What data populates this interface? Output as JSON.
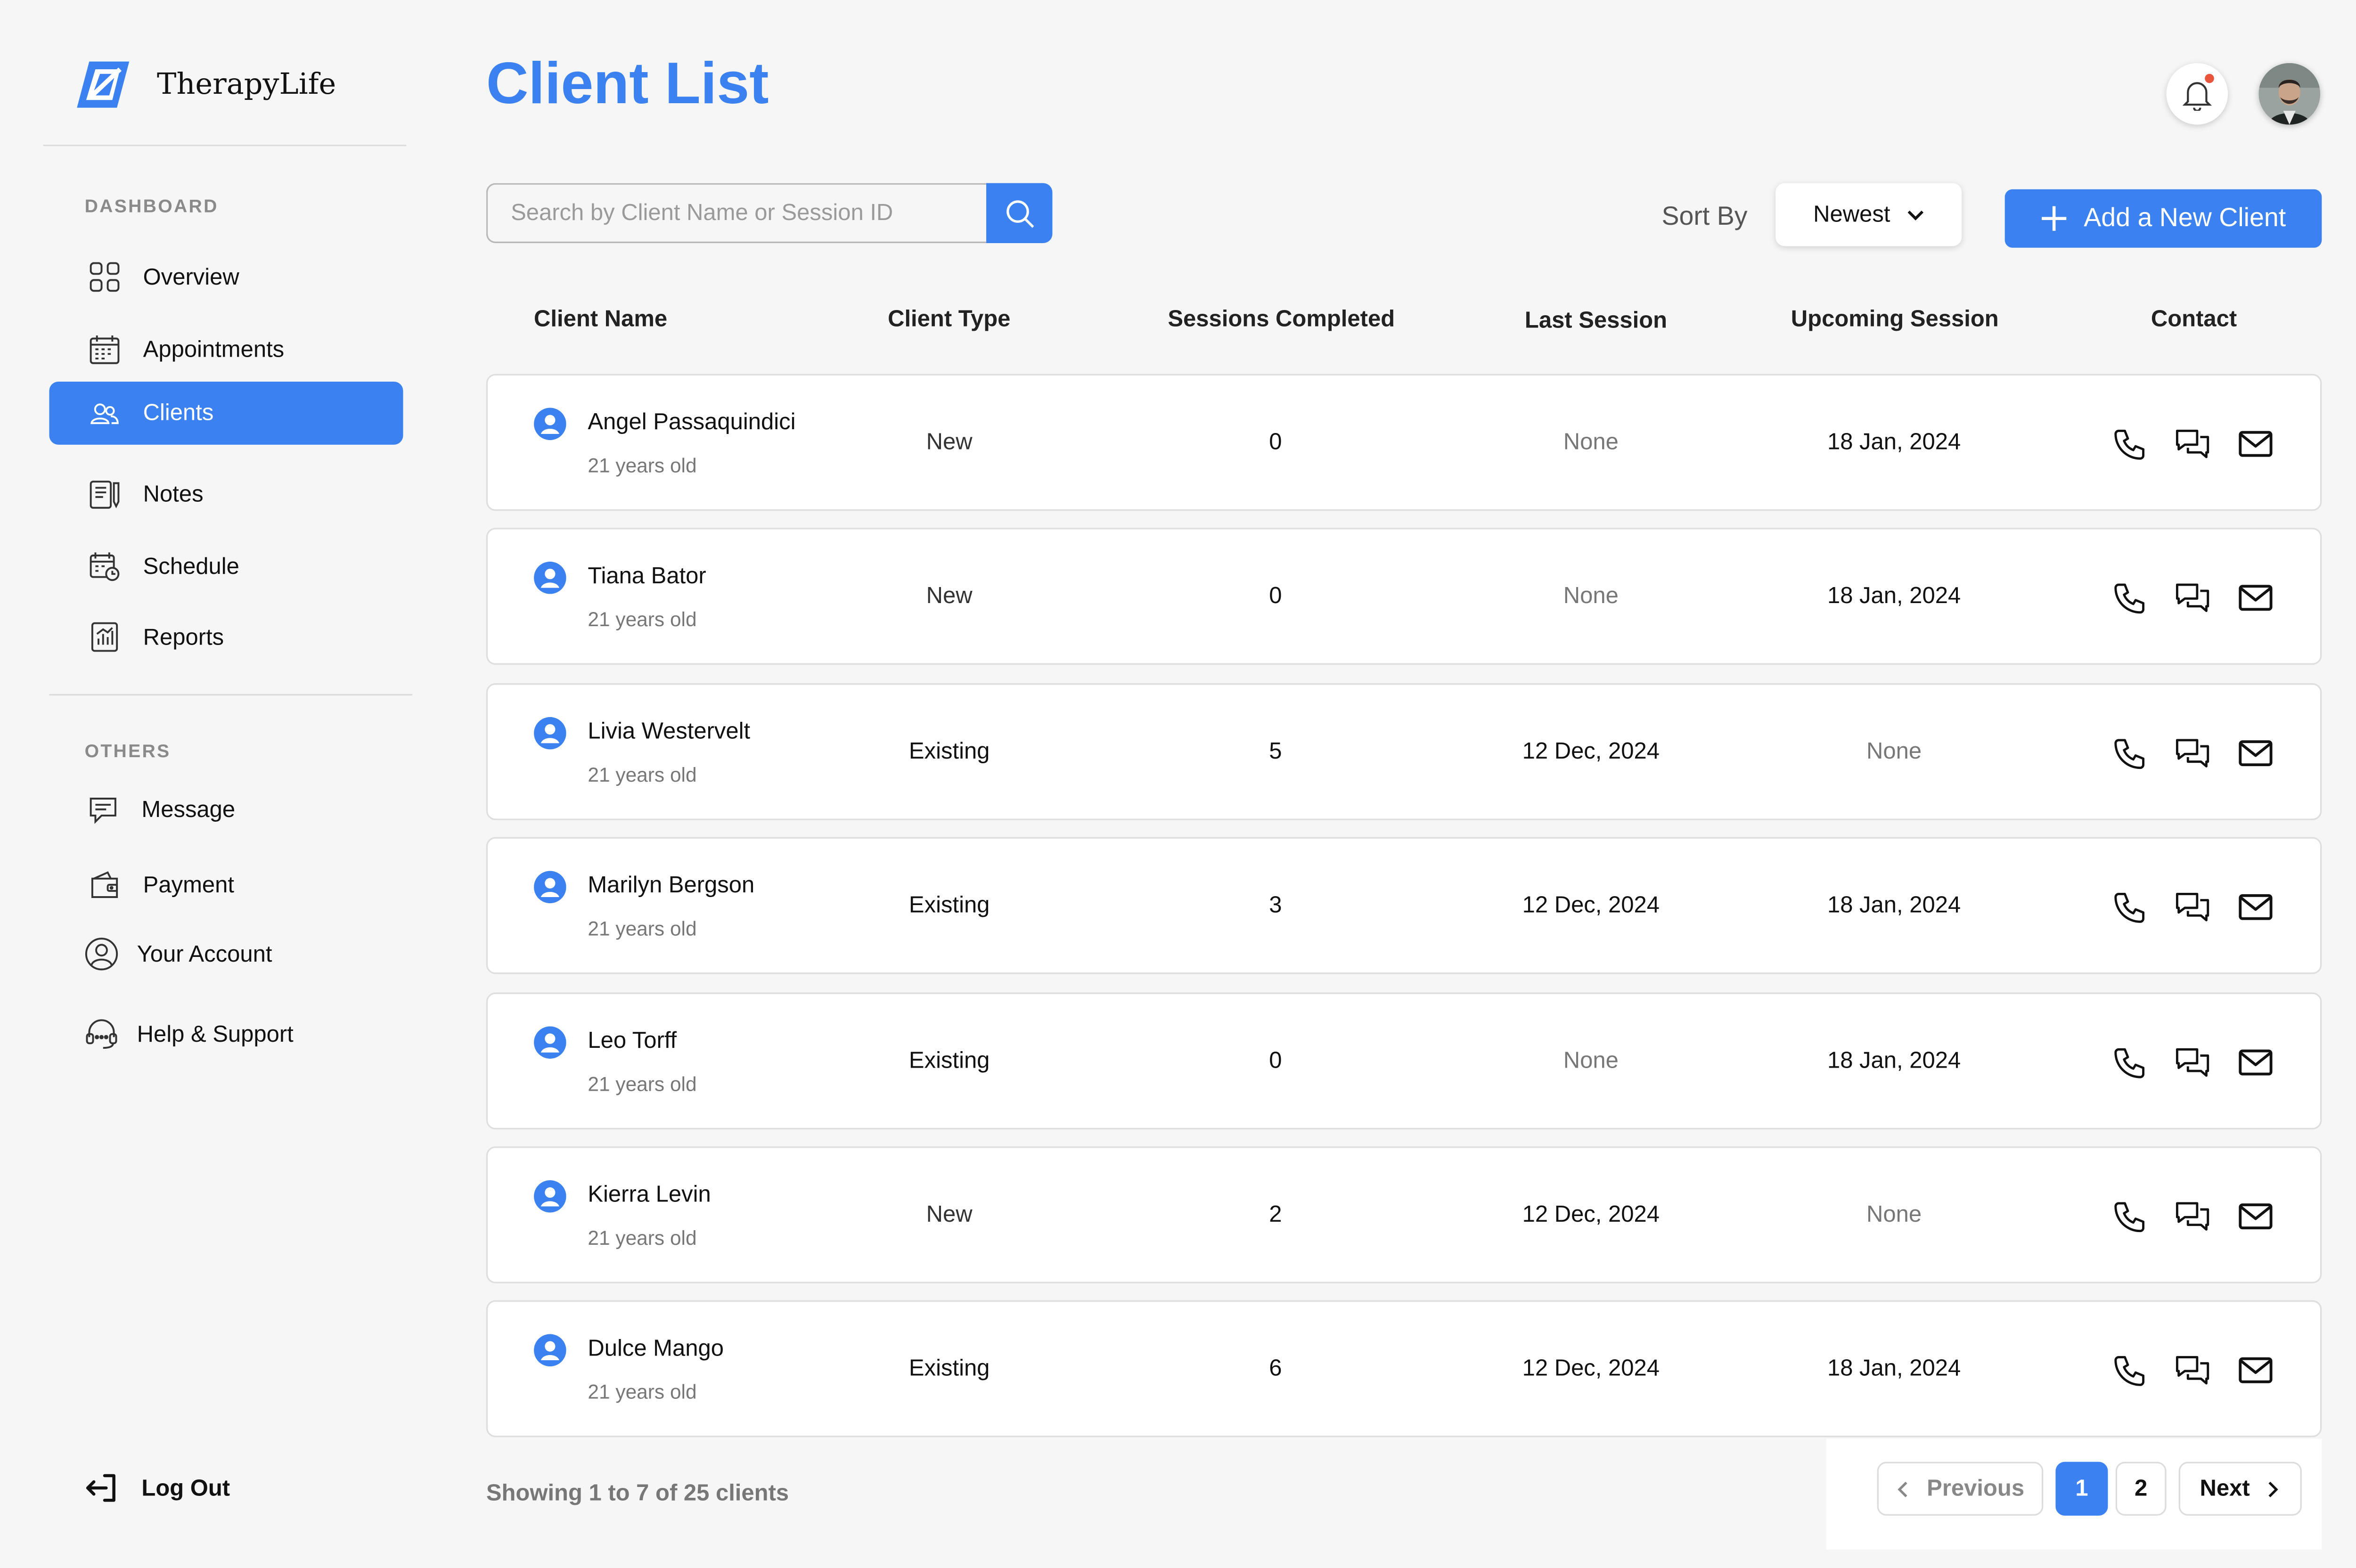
{
  "app": {
    "name": "TherapyLife"
  },
  "colors": {
    "accent": "#3b82f0",
    "notification_dot": "#e8543c"
  },
  "sidebar": {
    "section_dashboard": "DASHBOARD",
    "dashboard_items": [
      {
        "label": "Overview",
        "icon": "grid-icon"
      },
      {
        "label": "Appointments",
        "icon": "calendar-icon"
      },
      {
        "label": "Clients",
        "icon": "users-icon",
        "active": true
      },
      {
        "label": "Notes",
        "icon": "notes-icon"
      },
      {
        "label": "Schedule",
        "icon": "schedule-icon"
      },
      {
        "label": "Reports",
        "icon": "reports-icon"
      }
    ],
    "section_others": "OTHERS",
    "other_items": [
      {
        "label": "Message",
        "icon": "message-icon"
      },
      {
        "label": "Payment",
        "icon": "wallet-icon"
      },
      {
        "label": "Your Account",
        "icon": "account-icon"
      },
      {
        "label": "Help & Support",
        "icon": "headset-icon"
      }
    ],
    "logout_label": "Log Out"
  },
  "header": {
    "title": "Client List"
  },
  "toolbar": {
    "search_placeholder": "Search by Client Name or Session ID",
    "sort_label": "Sort By",
    "sort_value": "Newest",
    "add_label": "Add a New Client"
  },
  "table": {
    "columns": [
      "Client Name",
      "Client Type",
      "Sessions Completed",
      "Last Session",
      "Upcoming Session",
      "Contact"
    ],
    "rows": [
      {
        "name": "Angel Passaquindici",
        "age": "21 years old",
        "type": "New",
        "sessions": "0",
        "last": "None",
        "upcoming": "18 Jan, 2024"
      },
      {
        "name": "Tiana Bator",
        "age": "21 years old",
        "type": "New",
        "sessions": "0",
        "last": "None",
        "upcoming": "18 Jan, 2024"
      },
      {
        "name": "Livia Westervelt",
        "age": "21 years old",
        "type": "Existing",
        "sessions": "5",
        "last": "12 Dec, 2024",
        "upcoming": "None"
      },
      {
        "name": "Marilyn Bergson",
        "age": "21 years old",
        "type": "Existing",
        "sessions": "3",
        "last": "12 Dec, 2024",
        "upcoming": "18 Jan, 2024"
      },
      {
        "name": "Leo Torff",
        "age": "21 years old",
        "type": "Existing",
        "sessions": "0",
        "last": "None",
        "upcoming": "18 Jan, 2024"
      },
      {
        "name": "Kierra Levin",
        "age": "21 years old",
        "type": "New",
        "sessions": "2",
        "last": "12 Dec, 2024",
        "upcoming": "None"
      },
      {
        "name": "Dulce Mango",
        "age": "21 years old",
        "type": "Existing",
        "sessions": "6",
        "last": "12 Dec, 2024",
        "upcoming": "18 Jan, 2024"
      }
    ]
  },
  "footer": {
    "showing": "Showing 1 to 7 of 25 clients",
    "prev_label": "Previous",
    "pages": [
      "1",
      "2"
    ],
    "current_page": "1",
    "next_label": "Next"
  }
}
